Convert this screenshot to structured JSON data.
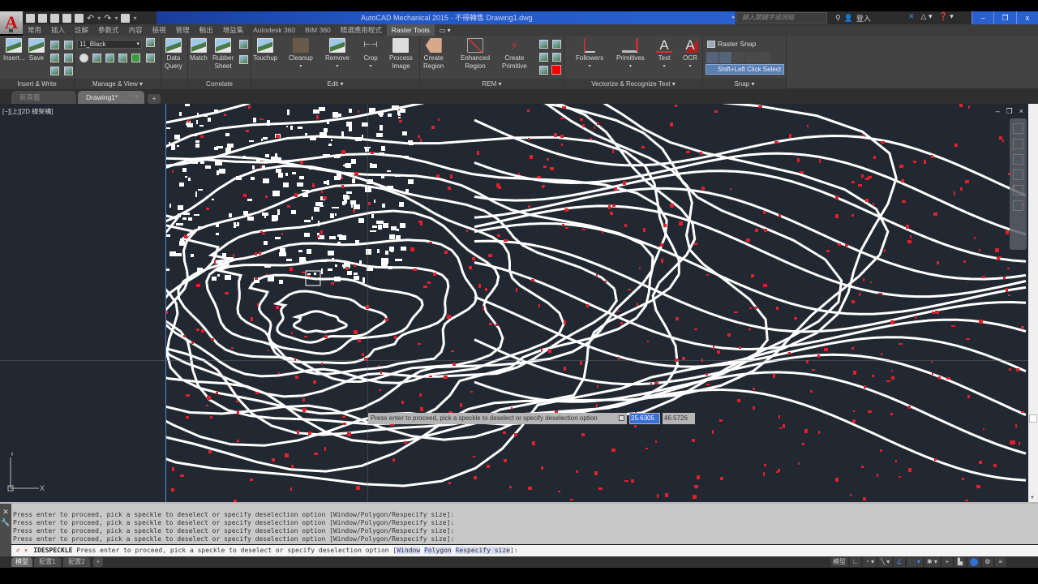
{
  "window": {
    "title": "AutoCAD Mechanical 2015 - 不得轉售   Drawing1.dwg",
    "search_placeholder": "鍵入關鍵字或詞組",
    "sign_in": "登入",
    "controls": [
      "–",
      "❐",
      "x"
    ]
  },
  "quick_access": [
    "new-icon",
    "open-icon",
    "save-icon",
    "save-as-icon",
    "plot-icon",
    "undo-icon",
    "redo-icon",
    "workspace-icon",
    "customize-icon"
  ],
  "ribbon_tabs": [
    {
      "label": "常用"
    },
    {
      "label": "插入"
    },
    {
      "label": "註解"
    },
    {
      "label": "參數式"
    },
    {
      "label": "內容"
    },
    {
      "label": "檢視"
    },
    {
      "label": "管理"
    },
    {
      "label": "輸出"
    },
    {
      "label": "增益集"
    },
    {
      "label": "Autodesk 360"
    },
    {
      "label": "BIM 360"
    },
    {
      "label": "精選應用程式"
    },
    {
      "label": "Raster Tools",
      "active": true
    }
  ],
  "ribbon_tab_extra": "▭ ▾",
  "ribbon": {
    "insert_write": {
      "title": "Insert & Write",
      "insert": "Insert...",
      "save": "Save"
    },
    "manage_view": {
      "title": "Manage & View ▾",
      "layer": "11_Black"
    },
    "data_query": {
      "line1": "Data",
      "line2": "Query"
    },
    "correlate": {
      "title": "Correlate",
      "match": "Match",
      "rubber1": "Rubber",
      "rubber2": "Sheet"
    },
    "edit": {
      "title": "Edit ▾",
      "touchup": "Touchup",
      "cleanup": "Cleanup",
      "remove": "Remove",
      "crop": "Crop",
      "process1": "Process",
      "process2": "Image"
    },
    "rem": {
      "title": "REM ▾",
      "create_region1": "Create",
      "create_region2": "Region",
      "enhanced1": "Enhanced",
      "enhanced2": "Region",
      "primitive1": "Create",
      "primitive2": "Primitive"
    },
    "vectorize": {
      "title": "Vectorize & Recognize Text ▾",
      "followers": "Followers",
      "primitives": "Primitives",
      "text": "Text",
      "ocr": "OCR"
    },
    "snap": {
      "title": "Snap ▾",
      "raster_snap": "Raster Snap",
      "shift_select": "Shift+Left Click Select"
    }
  },
  "doc_tabs": {
    "start": "新頁籤",
    "drawing": "Drawing1*",
    "close": "×",
    "add": "+"
  },
  "viewport": {
    "label": "[−][上][2D 線架構]",
    "controls": [
      "–",
      "❐",
      "×"
    ]
  },
  "command_tooltip": {
    "prompt": "Press enter to proceed, pick a speckle to deselect or specify deselection option",
    "x_value": "25.6305",
    "y_value": "46.5726"
  },
  "ucs": {
    "x": "X",
    "y": "Y"
  },
  "command_history": [
    "Press enter to proceed, pick a speckle to deselect or specify deselection option [Window/Polygon/Respecify size]:",
    "Press enter to proceed, pick a speckle to deselect or specify deselection option [Window/Polygon/Respecify size]:",
    "Press enter to proceed, pick a speckle to deselect or specify deselection option [Window/Polygon/Respecify size]:",
    "Press enter to proceed, pick a speckle to deselect or specify deselection option [Window/Polygon/Respecify size]:"
  ],
  "command_line": {
    "command": "IDESPECKLE",
    "prompt": "Press enter to proceed, pick a speckle to deselect or specify deselection option [",
    "options": [
      {
        "key": "W",
        "rest": "indow"
      },
      {
        "key": "P",
        "rest": "olygon"
      },
      {
        "key": "R",
        "rest": "especify size"
      }
    ],
    "suffix": "]:"
  },
  "layout_tabs": [
    "模型",
    "配置1",
    "配置2",
    "+"
  ],
  "status_bar": {
    "model": "模型",
    "tools": [
      "∟",
      "◔ ▾",
      "╲ ▾",
      "∠",
      "⬚ ▾",
      "✱ ▾",
      "+",
      "▙",
      "",
      "⚙",
      "≡"
    ]
  },
  "colors": {
    "canvas": "#222831",
    "contour": "#ffffff",
    "speckle": "#e0202a",
    "accent_blue": "#2357c6"
  }
}
